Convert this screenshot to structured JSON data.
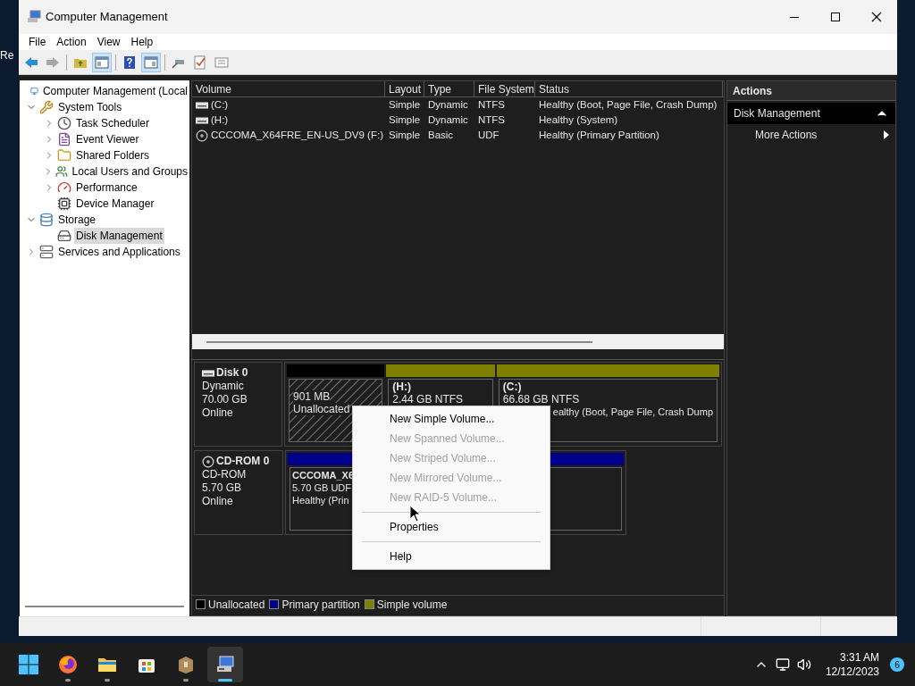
{
  "desktop": {
    "labels": [
      "Re"
    ]
  },
  "window": {
    "title": "Computer Management"
  },
  "menu": [
    "File",
    "Action",
    "View",
    "Help"
  ],
  "toolbar": [
    {
      "pressed": false,
      "disabled": false
    },
    {
      "pressed": false,
      "disabled": true
    },
    {
      "pressed": false,
      "disabled": false
    },
    {
      "pressed": true,
      "disabled": false
    },
    {
      "pressed": false,
      "disabled": false
    },
    {
      "pressed": true,
      "disabled": false
    },
    {
      "pressed": false,
      "disabled": false
    },
    {
      "pressed": false,
      "disabled": false
    },
    {
      "pressed": false,
      "disabled": false
    }
  ],
  "tree": [
    {
      "label": "Computer Management (Local",
      "selected": false,
      "children": [
        {
          "label": "System Tools",
          "expanded": true,
          "selected": false,
          "children": [
            {
              "label": "Task Scheduler",
              "expanded": false,
              "selected": false
            },
            {
              "label": "Event Viewer",
              "expanded": false,
              "selected": false
            },
            {
              "label": "Shared Folders",
              "expanded": false,
              "selected": false
            },
            {
              "label": "Local Users and Groups",
              "expanded": false,
              "selected": false
            },
            {
              "label": "Performance",
              "expanded": false,
              "selected": false
            },
            {
              "label": "Device Manager",
              "selected": false
            }
          ]
        },
        {
          "label": "Storage",
          "expanded": true,
          "selected": false,
          "children": [
            {
              "label": "Disk Management",
              "selected": true
            }
          ]
        },
        {
          "label": "Services and Applications",
          "expanded": false,
          "selected": false
        }
      ]
    }
  ],
  "volumes": {
    "columns": [
      "Volume",
      "Layout",
      "Type",
      "File System",
      "Status"
    ],
    "rows": [
      {
        "kind": "disk",
        "cells": [
          "(C:)",
          "Simple",
          "Dynamic",
          "NTFS",
          "Healthy (Boot, Page File, Crash Dump)"
        ]
      },
      {
        "kind": "disk",
        "cells": [
          "(H:)",
          "Simple",
          "Dynamic",
          "NTFS",
          "Healthy (System)"
        ]
      },
      {
        "kind": "cdrom",
        "cells": [
          "CCCOMA_X64FRE_EN-US_DV9 (F:)",
          "Simple",
          "Basic",
          "UDF",
          "Healthy (Primary Partition)"
        ]
      }
    ]
  },
  "disks": [
    {
      "kind": "disk",
      "name": "Disk 0",
      "lines": [
        "Dynamic",
        "70.00 GB",
        "Online"
      ],
      "partitions": [
        {
          "kind": "unallocated",
          "color": "#000000",
          "lines": [
            "901 MB",
            "Unallocated"
          ]
        },
        {
          "kind": "simple",
          "color": "#808000",
          "title": "(H:)",
          "lines": [
            "2.44 GB NTFS"
          ]
        },
        {
          "kind": "simple",
          "color": "#808000",
          "title": "(C:)",
          "lines": [
            "66.68 GB NTFS",
            "ealthy (Boot, Page File, Crash Dump"
          ]
        }
      ]
    },
    {
      "kind": "cdrom",
      "name": "CD-ROM 0",
      "lines": [
        "CD-ROM",
        "5.70 GB",
        "Online"
      ],
      "partitions": [
        {
          "kind": "primary",
          "color": "#00008b",
          "title": "CCCOMA_X6",
          "lines": [
            "5.70 GB UDF",
            "Healthy (Prin"
          ]
        }
      ]
    }
  ],
  "legend": [
    {
      "label": "Unallocated",
      "color": "#000000"
    },
    {
      "label": "Primary partition",
      "color": "#00008b"
    },
    {
      "label": "Simple volume",
      "color": "#808000"
    }
  ],
  "actions": {
    "title": "Actions",
    "section": "Disk Management",
    "items": [
      "More Actions"
    ]
  },
  "context_menu": [
    {
      "kind": "item",
      "label": "New Simple Volume...",
      "disabled": false
    },
    {
      "kind": "item",
      "label": "New Spanned Volume...",
      "disabled": true
    },
    {
      "kind": "item",
      "label": "New Striped Volume...",
      "disabled": true
    },
    {
      "kind": "item",
      "label": "New Mirrored Volume...",
      "disabled": true
    },
    {
      "kind": "item",
      "label": "New RAID-5 Volume...",
      "disabled": true
    },
    {
      "kind": "separator"
    },
    {
      "kind": "item",
      "label": "Properties",
      "disabled": false
    },
    {
      "kind": "separator"
    },
    {
      "kind": "item",
      "label": "Help",
      "disabled": false
    }
  ],
  "taskbar": {
    "apps": [
      {
        "running": true,
        "selected": false
      },
      {
        "running": true,
        "selected": false
      },
      {
        "running": false,
        "selected": false
      },
      {
        "running": true,
        "selected": false
      },
      {
        "running": true,
        "selected": true
      }
    ],
    "time": "3:31 AM",
    "date": "12/12/2023",
    "badge": "6"
  }
}
